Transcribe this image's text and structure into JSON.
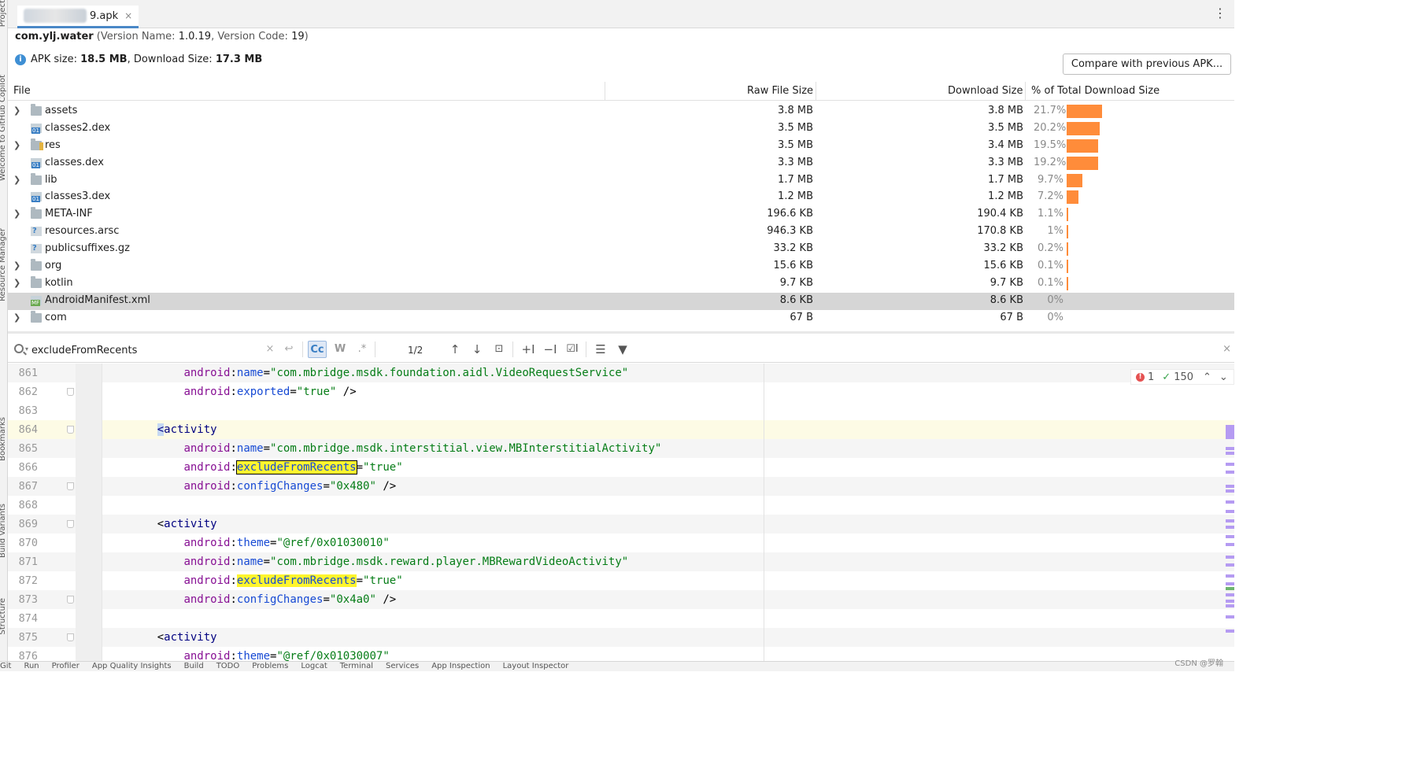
{
  "left_tools": [
    "Project",
    "Welcome to GitHub Copilot",
    "Resource Manager",
    "Bookmarks",
    "Build Variants",
    "Structure"
  ],
  "tab": {
    "label": "9.apk",
    "close": "×"
  },
  "package": {
    "id": "com.ylj.water",
    "version_name_label": "Version Name:",
    "version_name": "1.0.19",
    "version_code_label": "Version Code:",
    "version_code": "19"
  },
  "sizes": {
    "apk_label": "APK size:",
    "apk": "18.5 MB",
    "download_label": "Download Size:",
    "download": "17.3 MB"
  },
  "compare_button": "Compare with previous APK...",
  "table": {
    "columns": [
      "File",
      "Raw File Size",
      "Download Size",
      "% of Total Download Size"
    ],
    "rows": [
      {
        "name": "assets",
        "icon": "folder-icon",
        "expandable": true,
        "raw": "3.8 MB",
        "download": "3.8 MB",
        "percent": "21.7%",
        "pct_value": 21.7
      },
      {
        "name": "classes2.dex",
        "icon": "dex-file-icon",
        "expandable": false,
        "raw": "3.5 MB",
        "download": "3.5 MB",
        "percent": "20.2%",
        "pct_value": 20.2
      },
      {
        "name": "res",
        "icon": "resource-folder-icon",
        "expandable": true,
        "raw": "3.5 MB",
        "download": "3.4 MB",
        "percent": "19.5%",
        "pct_value": 19.5
      },
      {
        "name": "classes.dex",
        "icon": "dex-file-icon",
        "expandable": false,
        "raw": "3.3 MB",
        "download": "3.3 MB",
        "percent": "19.2%",
        "pct_value": 19.2
      },
      {
        "name": "lib",
        "icon": "folder-icon",
        "expandable": true,
        "raw": "1.7 MB",
        "download": "1.7 MB",
        "percent": "9.7%",
        "pct_value": 9.7
      },
      {
        "name": "classes3.dex",
        "icon": "dex-file-icon",
        "expandable": false,
        "raw": "1.2 MB",
        "download": "1.2 MB",
        "percent": "7.2%",
        "pct_value": 7.2
      },
      {
        "name": "META-INF",
        "icon": "folder-icon",
        "expandable": true,
        "raw": "196.6 KB",
        "download": "190.4 KB",
        "percent": "1.1%",
        "pct_value": 1.1
      },
      {
        "name": "resources.arsc",
        "icon": "unknown-file-icon",
        "expandable": false,
        "raw": "946.3 KB",
        "download": "170.8 KB",
        "percent": "1%",
        "pct_value": 1.0
      },
      {
        "name": "publicsuffixes.gz",
        "icon": "unknown-file-icon",
        "expandable": false,
        "raw": "33.2 KB",
        "download": "33.2 KB",
        "percent": "0.2%",
        "pct_value": 0.2
      },
      {
        "name": "org",
        "icon": "folder-icon",
        "expandable": true,
        "raw": "15.6 KB",
        "download": "15.6 KB",
        "percent": "0.1%",
        "pct_value": 0.1
      },
      {
        "name": "kotlin",
        "icon": "folder-icon",
        "expandable": true,
        "raw": "9.7 KB",
        "download": "9.7 KB",
        "percent": "0.1%",
        "pct_value": 0.1
      },
      {
        "name": "AndroidManifest.xml",
        "icon": "manifest-file-icon",
        "expandable": false,
        "selected": true,
        "raw": "8.6 KB",
        "download": "8.6 KB",
        "percent": "0%",
        "pct_value": 0
      },
      {
        "name": "com",
        "icon": "folder-icon",
        "expandable": true,
        "raw": "67 B",
        "download": "67 B",
        "percent": "0%",
        "pct_value": 0
      }
    ],
    "bar_color": "#ff8c3a"
  },
  "search": {
    "query": "excludeFromRecents",
    "case_label": "Cc",
    "word_label": "W",
    "regex_label": ".*",
    "counter": "1/2"
  },
  "inspections": {
    "errors": "1",
    "ok": "150"
  },
  "editor": {
    "lines": [
      {
        "n": "861",
        "tokens": [
          [
            "plain",
            "        "
          ],
          [
            "ns",
            "android"
          ],
          [
            "plain",
            ":"
          ],
          [
            "attr",
            "name"
          ],
          [
            "plain",
            "="
          ],
          [
            "str",
            "\"com.mbridge.msdk.foundation.aidl.VideoRequestService\""
          ]
        ]
      },
      {
        "n": "862",
        "tokens": [
          [
            "plain",
            "        "
          ],
          [
            "ns",
            "android"
          ],
          [
            "plain",
            ":"
          ],
          [
            "attr",
            "exported"
          ],
          [
            "plain",
            "="
          ],
          [
            "str",
            "\"true\""
          ],
          [
            "plain",
            " />"
          ]
        ],
        "fold": true
      },
      {
        "n": "863",
        "tokens": []
      },
      {
        "n": "864",
        "tokens": [
          [
            "plain",
            "    "
          ],
          [
            "bracket",
            "<"
          ],
          [
            "tag",
            "activity"
          ]
        ],
        "fold": true,
        "caret": true
      },
      {
        "n": "865",
        "tokens": [
          [
            "plain",
            "        "
          ],
          [
            "ns",
            "android"
          ],
          [
            "plain",
            ":"
          ],
          [
            "attr",
            "name"
          ],
          [
            "plain",
            "="
          ],
          [
            "str",
            "\"com.mbridge.msdk.interstitial.view.MBInterstitialActivity\""
          ]
        ]
      },
      {
        "n": "866",
        "tokens": [
          [
            "plain",
            "        "
          ],
          [
            "ns",
            "android"
          ],
          [
            "plain",
            ":"
          ],
          [
            "hlcur",
            "excludeFromRecents"
          ],
          [
            "plain",
            "="
          ],
          [
            "str",
            "\"true\""
          ]
        ]
      },
      {
        "n": "867",
        "tokens": [
          [
            "plain",
            "        "
          ],
          [
            "ns",
            "android"
          ],
          [
            "plain",
            ":"
          ],
          [
            "attr",
            "configChanges"
          ],
          [
            "plain",
            "="
          ],
          [
            "str",
            "\"0x480\""
          ],
          [
            "plain",
            " />"
          ]
        ],
        "fold": true
      },
      {
        "n": "868",
        "tokens": []
      },
      {
        "n": "869",
        "tokens": [
          [
            "plain",
            "    "
          ],
          [
            "plain",
            "<"
          ],
          [
            "tag",
            "activity"
          ]
        ],
        "fold": true
      },
      {
        "n": "870",
        "tokens": [
          [
            "plain",
            "        "
          ],
          [
            "ns",
            "android"
          ],
          [
            "plain",
            ":"
          ],
          [
            "attr",
            "theme"
          ],
          [
            "plain",
            "="
          ],
          [
            "str",
            "\"@ref/0x01030010\""
          ]
        ]
      },
      {
        "n": "871",
        "tokens": [
          [
            "plain",
            "        "
          ],
          [
            "ns",
            "android"
          ],
          [
            "plain",
            ":"
          ],
          [
            "attr",
            "name"
          ],
          [
            "plain",
            "="
          ],
          [
            "str",
            "\"com.mbridge.msdk.reward.player.MBRewardVideoActivity\""
          ]
        ]
      },
      {
        "n": "872",
        "tokens": [
          [
            "plain",
            "        "
          ],
          [
            "ns",
            "android"
          ],
          [
            "plain",
            ":"
          ],
          [
            "hl",
            "excludeFromRecents"
          ],
          [
            "plain",
            "="
          ],
          [
            "str",
            "\"true\""
          ]
        ]
      },
      {
        "n": "873",
        "tokens": [
          [
            "plain",
            "        "
          ],
          [
            "ns",
            "android"
          ],
          [
            "plain",
            ":"
          ],
          [
            "attr",
            "configChanges"
          ],
          [
            "plain",
            "="
          ],
          [
            "str",
            "\"0x4a0\""
          ],
          [
            "plain",
            " />"
          ]
        ],
        "fold": true
      },
      {
        "n": "874",
        "tokens": []
      },
      {
        "n": "875",
        "tokens": [
          [
            "plain",
            "    "
          ],
          [
            "plain",
            "<"
          ],
          [
            "tag",
            "activity"
          ]
        ],
        "fold": true
      },
      {
        "n": "876",
        "tokens": [
          [
            "plain",
            "        "
          ],
          [
            "ns",
            "android"
          ],
          [
            "plain",
            ":"
          ],
          [
            "attr",
            "theme"
          ],
          [
            "plain",
            "="
          ],
          [
            "str",
            "\"@ref/0x01030007\""
          ]
        ]
      }
    ]
  },
  "bottom_tools": [
    "Git",
    "Run",
    "Profiler",
    "App Quality Insights",
    "Build",
    "TODO",
    "Problems",
    "Logcat",
    "Terminal",
    "Services",
    "App Inspection",
    "Layout Inspector"
  ],
  "watermark": "CSDN @罗翰"
}
